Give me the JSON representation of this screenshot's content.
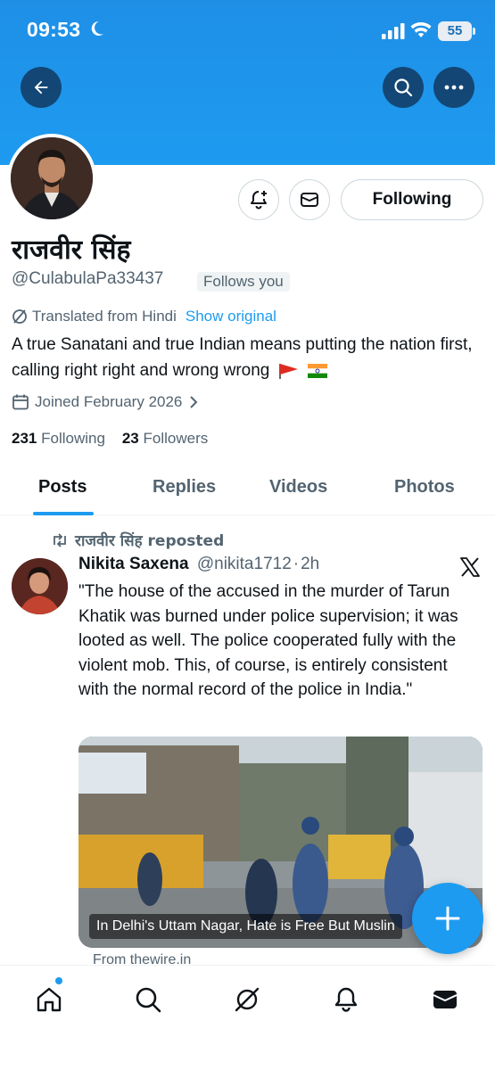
{
  "status_bar": {
    "time": "09:53",
    "battery": "55"
  },
  "profile": {
    "display_name": "राजवीर सिंह",
    "handle": "@CulabulaPa33437",
    "follows_you": "Follows you",
    "translated_from": "Translated from Hindi",
    "show_original": "Show original",
    "bio": "A true Sanatani and true Indian means putting the nation first, calling right right and wrong wrong",
    "joined": "Joined February 2026",
    "following_count": "231",
    "following_label": "Following",
    "followers_count": "23",
    "followers_label": "Followers",
    "following_button": "Following"
  },
  "tabs": [
    {
      "label": "Posts",
      "active": true
    },
    {
      "label": "Replies",
      "active": false
    },
    {
      "label": "Videos",
      "active": false
    },
    {
      "label": "Photos",
      "active": false
    }
  ],
  "post": {
    "repost_label": "राजवीर सिंह reposted",
    "author_name": "Nikita Saxena",
    "author_handle": "@nikita1712",
    "time": "2h",
    "text": "\"The house of the accused in the murder of Tarun Khatik was burned under police supervision; it was looted as well. The police cooperated fully with the violent mob. This, of course, is entirely consistent with the normal record of the police in India.\"",
    "media_caption": "In Delhi's Uttam Nagar, Hate is Free But Muslin",
    "source": "From thewire.in"
  },
  "colors": {
    "accent": "#1d9bf0",
    "text": "#0f1419",
    "secondary": "#536471"
  },
  "icons": [
    "back-arrow-icon",
    "search-icon",
    "more-icon",
    "notification-plus-icon",
    "message-icon",
    "translate-icon",
    "calendar-icon",
    "repost-icon",
    "x-logo-icon",
    "compose-plus-icon",
    "home-icon",
    "grok-icon",
    "bell-icon",
    "mail-icon"
  ]
}
